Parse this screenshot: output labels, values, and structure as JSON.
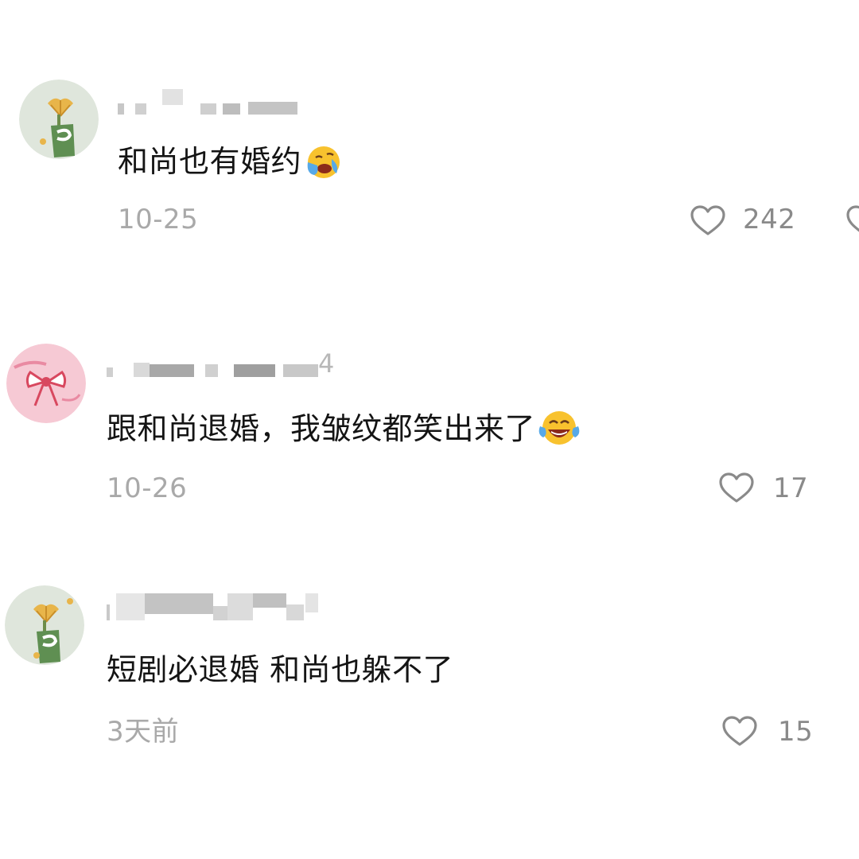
{
  "comments": [
    {
      "avatar": "ginkgo-cup-avatar",
      "text": "和尚也有婚约",
      "emoji": "crying-face-emoji",
      "date": "10-25",
      "likes": "242"
    },
    {
      "avatar": "pink-bow-avatar",
      "text": "跟和尚退婚，我皱纹都笑出来了",
      "emoji": "tears-of-joy-emoji",
      "date": "10-26",
      "likes": "17",
      "username_suffix": "4"
    },
    {
      "avatar": "ginkgo-cup-avatar",
      "text": "短剧必退婚 和尚也躲不了",
      "date": "3天前",
      "likes": "15"
    }
  ],
  "colors": {
    "text": "#141414",
    "meta": "#a9a9a9",
    "like": "#8a8a8a",
    "avatar_green_bg": "#dfe6dc",
    "avatar_pink_bg": "#f6c9d4"
  }
}
